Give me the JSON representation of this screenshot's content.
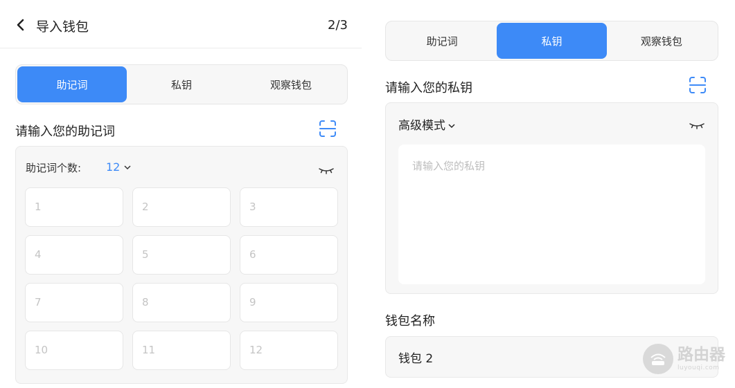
{
  "left": {
    "header": {
      "title": "导入钱包",
      "step": "2/3"
    },
    "tabs": [
      {
        "label": "助记词",
        "active": true
      },
      {
        "label": "私钥",
        "active": false
      },
      {
        "label": "观察钱包",
        "active": false
      }
    ],
    "section_label": "请输入您的助记词",
    "mnemonic": {
      "count_label": "助记词个数:",
      "count_value": "12",
      "placeholders": [
        "1",
        "2",
        "3",
        "4",
        "5",
        "6",
        "7",
        "8",
        "9",
        "10",
        "11",
        "12"
      ]
    }
  },
  "right": {
    "tabs": [
      {
        "label": "助记词",
        "active": false
      },
      {
        "label": "私钥",
        "active": true
      },
      {
        "label": "观察钱包",
        "active": false
      }
    ],
    "section_label": "请输入您的私钥",
    "mode_label": "高级模式",
    "key_placeholder": "请输入您的私钥",
    "wallet_name_label": "钱包名称",
    "wallet_name_value": "钱包 2"
  },
  "watermark": {
    "main": "路由器",
    "sub": "luyouqi.com"
  },
  "colors": {
    "accent": "#3d8af7",
    "panel_bg": "#f7f7f7",
    "placeholder": "#c4c4c4"
  },
  "icons": [
    "back-arrow-icon",
    "scan-icon",
    "chevron-down-icon",
    "eye-closed-icon",
    "router-logo-icon"
  ]
}
